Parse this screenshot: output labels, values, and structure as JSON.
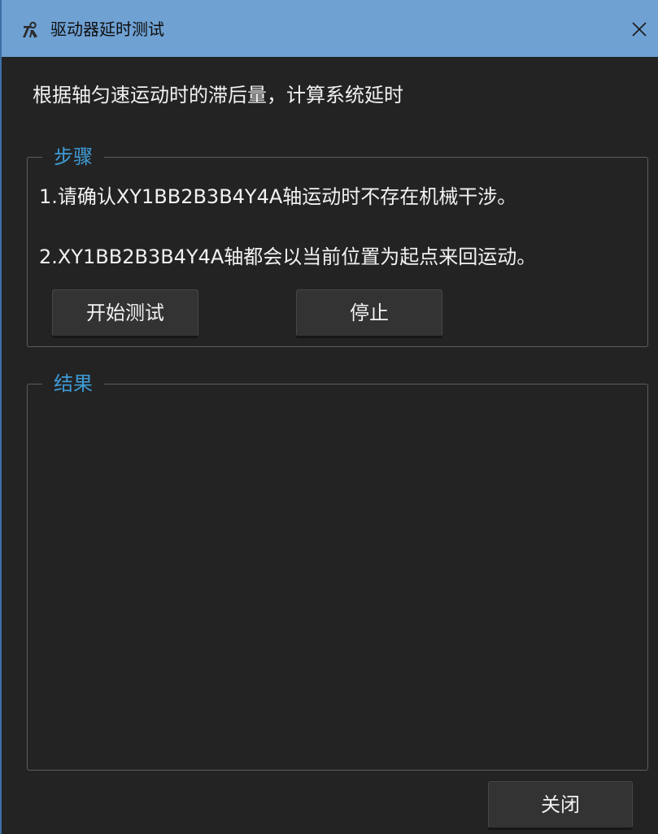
{
  "window": {
    "title": "驱动器延时测试",
    "app_icon": "wrench-hammer-icon",
    "close_icon": "close-icon"
  },
  "main": {
    "description": "根据轴匀速运动时的滞后量，计算系统延时"
  },
  "steps_group": {
    "legend": "步骤",
    "step1": "1.请确认XY1BB2B3B4Y4A轴运动时不存在机械干涉。",
    "step2": "2.XY1BB2B3B4Y4A轴都会以当前位置为起点来回运动。",
    "start_button": "开始测试",
    "stop_button": "停止"
  },
  "result_group": {
    "legend": "结果",
    "content": ""
  },
  "footer": {
    "close_button": "关闭"
  },
  "colors": {
    "titlebar": "#6fa1d3",
    "background": "#232323",
    "legend_accent": "#3e9bd6",
    "text": "#f2f2f2",
    "button": "#333333"
  }
}
